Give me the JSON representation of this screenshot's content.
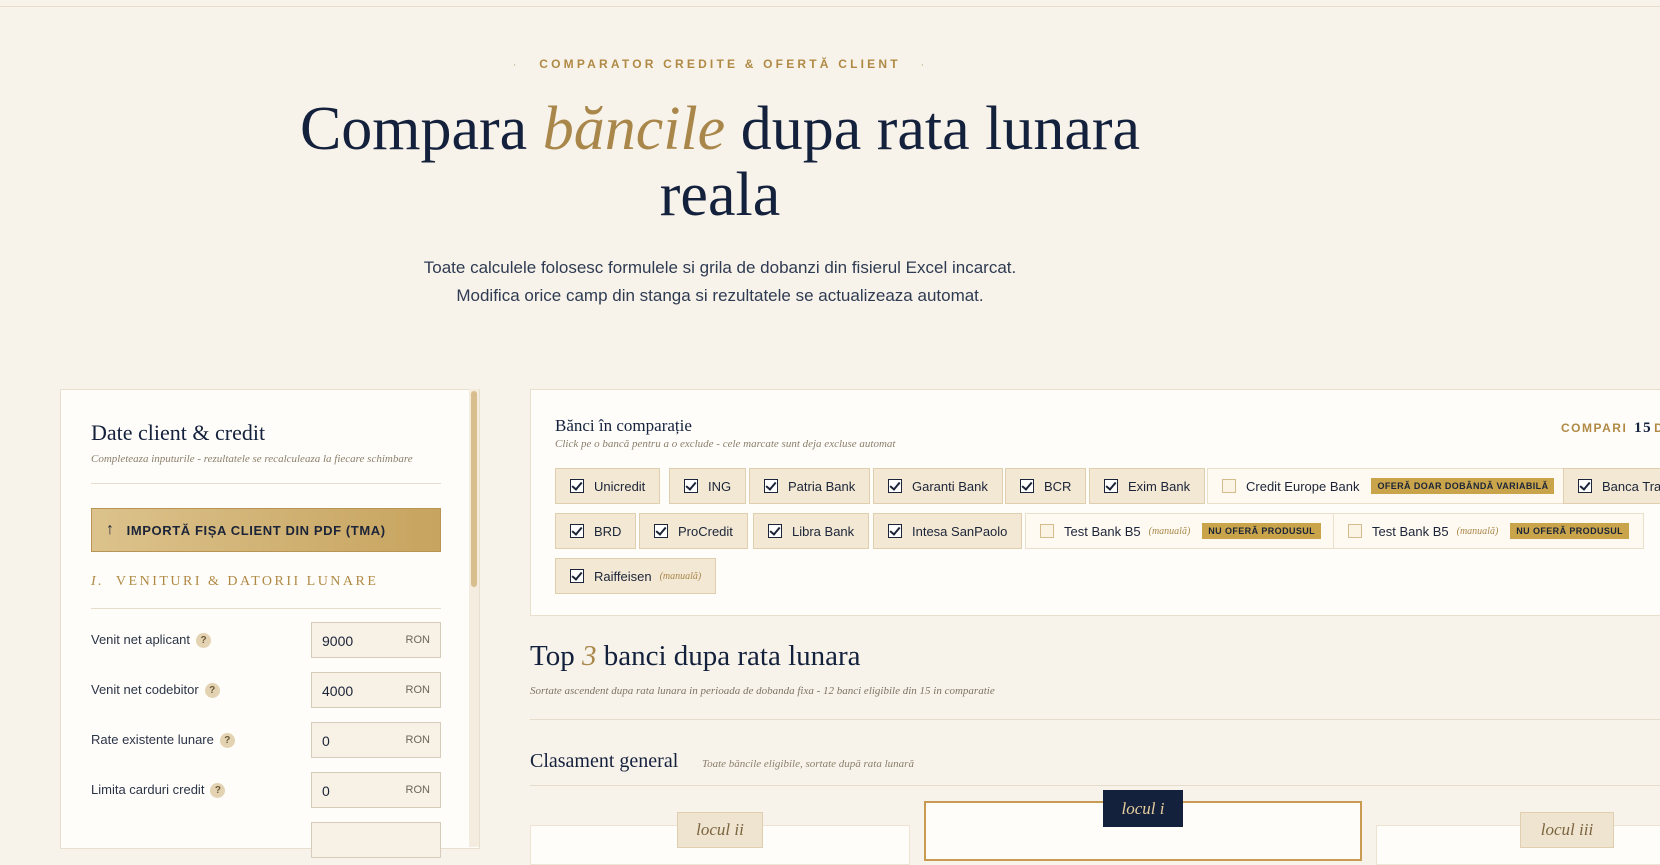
{
  "hero": {
    "eyebrow": "COMPARATOR CREDITE & OFERTĂ CLIENT",
    "eyebrow_dot": "·",
    "title_pre": "Compara",
    "title_accent": "băncile",
    "title_post": "dupa rata lunara reala",
    "subtitle_line1": "Toate calculele folosesc formulele si grila de dobanzi din fisierul Excel incarcat.",
    "subtitle_line2": "Modifica orice camp din stanga si rezultatele se actualizeaza automat."
  },
  "client_panel": {
    "title": "Date client & credit",
    "subtitle": "Completeaza inputurile - rezultatele se recalculeaza la fiecare schimbare",
    "import_label": "IMPORTĂ FIȘA CLIENT DIN PDF (TMA)",
    "import_icon": "↑",
    "section_number": "I.",
    "section_title": "VENITURI & DATORII LUNARE",
    "help_glyph": "?",
    "fields": [
      {
        "label": "Venit net aplicant",
        "value": "9000",
        "unit": "RON"
      },
      {
        "label": "Venit net codebitor",
        "value": "4000",
        "unit": "RON"
      },
      {
        "label": "Rate existente lunare",
        "value": "0",
        "unit": "RON"
      },
      {
        "label": "Limita carduri credit",
        "value": "0",
        "unit": "RON"
      }
    ]
  },
  "banks": {
    "title": "Bănci în comparație",
    "subtitle": "Click pe o bancă pentru a o exclude - cele marcate sunt deja excluse automat",
    "count_prefix": "COMPARI",
    "count_value": "15",
    "count_suffix": "DI",
    "manual_tag": "(manuală)",
    "chips": [
      {
        "name": "Unicredit",
        "checked": true
      },
      {
        "name": "ING",
        "checked": true
      },
      {
        "name": "Patria Bank",
        "checked": true
      },
      {
        "name": "Garanti Bank",
        "checked": true
      },
      {
        "name": "BCR",
        "checked": true
      },
      {
        "name": "Exim Bank",
        "checked": true
      },
      {
        "name": "Credit Europe Bank",
        "checked": false,
        "badge": "OFERĂ DOAR DOBÂNDĂ VARIABILĂ"
      },
      {
        "name": "Banca Tran",
        "checked": true
      },
      {
        "name": "BRD",
        "checked": true
      },
      {
        "name": "ProCredit",
        "checked": true
      },
      {
        "name": "Libra Bank",
        "checked": true
      },
      {
        "name": "Intesa SanPaolo",
        "checked": true
      },
      {
        "name": "Test Bank B5",
        "checked": false,
        "manual": true,
        "badge": "NU OFERĂ PRODUSUL"
      },
      {
        "name": "Test Bank B5",
        "checked": false,
        "manual": true,
        "badge": "NU OFERĂ PRODUSUL"
      },
      {
        "name": "Raiffeisen",
        "checked": true,
        "manual": true
      }
    ]
  },
  "top3": {
    "title_pre": "Top",
    "title_accent": "3",
    "title_post": "banci dupa rata lunara",
    "subtitle": "Sortate ascendent dupa rata lunara in perioada de dobanda fixa - 12 banci eligibile din 15 in comparatie",
    "ranking_title": "Clasament general",
    "ranking_subtitle": "Toate băncile eligibile, sortate după rata lunară",
    "place_2": "locul ii",
    "place_1": "locul i",
    "place_3": "locul iii"
  },
  "colors": {
    "background": "#f8f3ea",
    "navy": "#14213d",
    "gold": "#a9874b",
    "badge_gold": "#c9a44a"
  }
}
